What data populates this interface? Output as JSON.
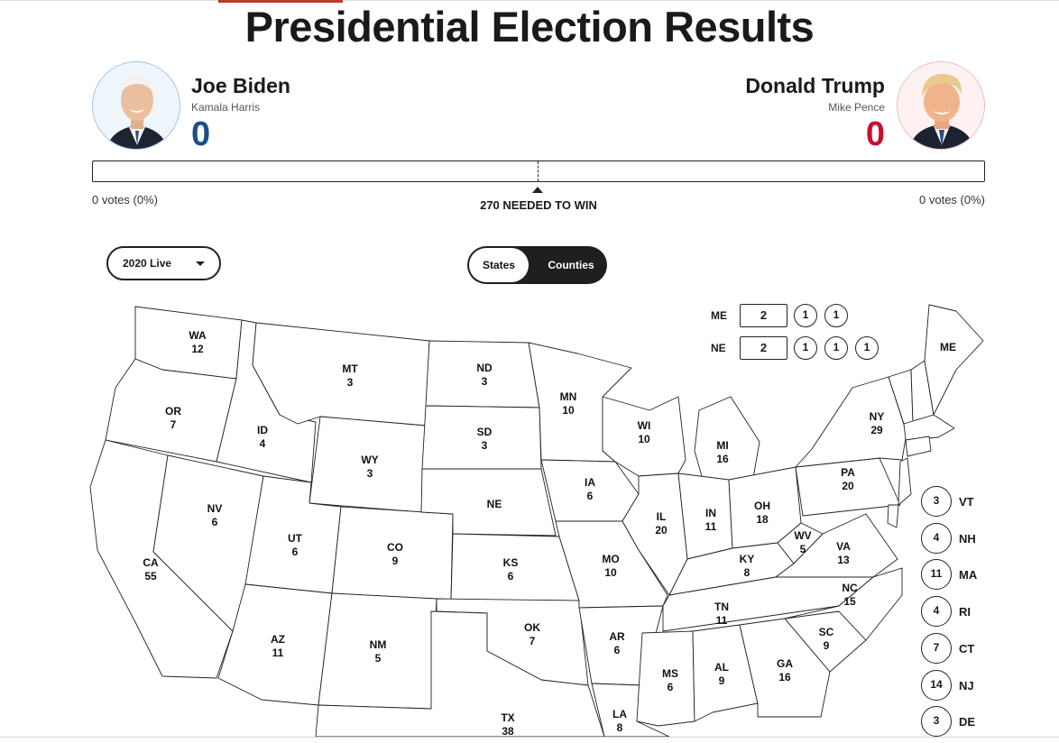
{
  "title": "Presidential Election Results",
  "candidates": {
    "dem": {
      "name": "Joe Biden",
      "vp": "Kamala Harris",
      "electoral_votes": "0",
      "votes_text": "0 votes (0%)",
      "color": "#1a4f8a",
      "photo_icon": "biden-portrait"
    },
    "rep": {
      "name": "Donald Trump",
      "vp": "Mike Pence",
      "electoral_votes": "0",
      "votes_text": "0 votes (0%)",
      "color": "#c8102e",
      "photo_icon": "trump-portrait"
    }
  },
  "needed_to_win": "270 NEEDED TO WIN",
  "controls": {
    "year_select": "2020 Live",
    "toggle": {
      "states": "States",
      "counties": "Counties",
      "active": "States"
    }
  },
  "split_states": [
    {
      "abbr": "ME",
      "total": "2",
      "districts": [
        "1",
        "1"
      ]
    },
    {
      "abbr": "NE",
      "total": "2",
      "districts": [
        "1",
        "1",
        "1"
      ]
    }
  ],
  "states": [
    {
      "abbr": "WA",
      "ev": "12"
    },
    {
      "abbr": "OR",
      "ev": "7"
    },
    {
      "abbr": "CA",
      "ev": "55"
    },
    {
      "abbr": "ID",
      "ev": "4"
    },
    {
      "abbr": "NV",
      "ev": "6"
    },
    {
      "abbr": "MT",
      "ev": "3"
    },
    {
      "abbr": "WY",
      "ev": "3"
    },
    {
      "abbr": "UT",
      "ev": "6"
    },
    {
      "abbr": "AZ",
      "ev": "11"
    },
    {
      "abbr": "CO",
      "ev": "9"
    },
    {
      "abbr": "NM",
      "ev": "5"
    },
    {
      "abbr": "ND",
      "ev": "3"
    },
    {
      "abbr": "SD",
      "ev": "3"
    },
    {
      "abbr": "NE",
      "ev": ""
    },
    {
      "abbr": "KS",
      "ev": "6"
    },
    {
      "abbr": "OK",
      "ev": "7"
    },
    {
      "abbr": "TX",
      "ev": "38"
    },
    {
      "abbr": "MN",
      "ev": "10"
    },
    {
      "abbr": "IA",
      "ev": "6"
    },
    {
      "abbr": "MO",
      "ev": "10"
    },
    {
      "abbr": "AR",
      "ev": "6"
    },
    {
      "abbr": "LA",
      "ev": "8"
    },
    {
      "abbr": "WI",
      "ev": "10"
    },
    {
      "abbr": "IL",
      "ev": "20"
    },
    {
      "abbr": "MI",
      "ev": "16"
    },
    {
      "abbr": "IN",
      "ev": "11"
    },
    {
      "abbr": "OH",
      "ev": "18"
    },
    {
      "abbr": "KY",
      "ev": "8"
    },
    {
      "abbr": "TN",
      "ev": "11"
    },
    {
      "abbr": "MS",
      "ev": "6"
    },
    {
      "abbr": "AL",
      "ev": "9"
    },
    {
      "abbr": "GA",
      "ev": "16"
    },
    {
      "abbr": "SC",
      "ev": "9"
    },
    {
      "abbr": "NC",
      "ev": "15"
    },
    {
      "abbr": "VA",
      "ev": "13"
    },
    {
      "abbr": "WV",
      "ev": "5"
    },
    {
      "abbr": "PA",
      "ev": "20"
    },
    {
      "abbr": "NY",
      "ev": "29"
    },
    {
      "abbr": "ME",
      "ev": ""
    }
  ],
  "northeast_small": [
    {
      "abbr": "VT",
      "ev": "3"
    },
    {
      "abbr": "NH",
      "ev": "4"
    },
    {
      "abbr": "MA",
      "ev": "11"
    },
    {
      "abbr": "RI",
      "ev": "4"
    },
    {
      "abbr": "CT",
      "ev": "7"
    },
    {
      "abbr": "NJ",
      "ev": "14"
    },
    {
      "abbr": "DE",
      "ev": "3"
    }
  ]
}
